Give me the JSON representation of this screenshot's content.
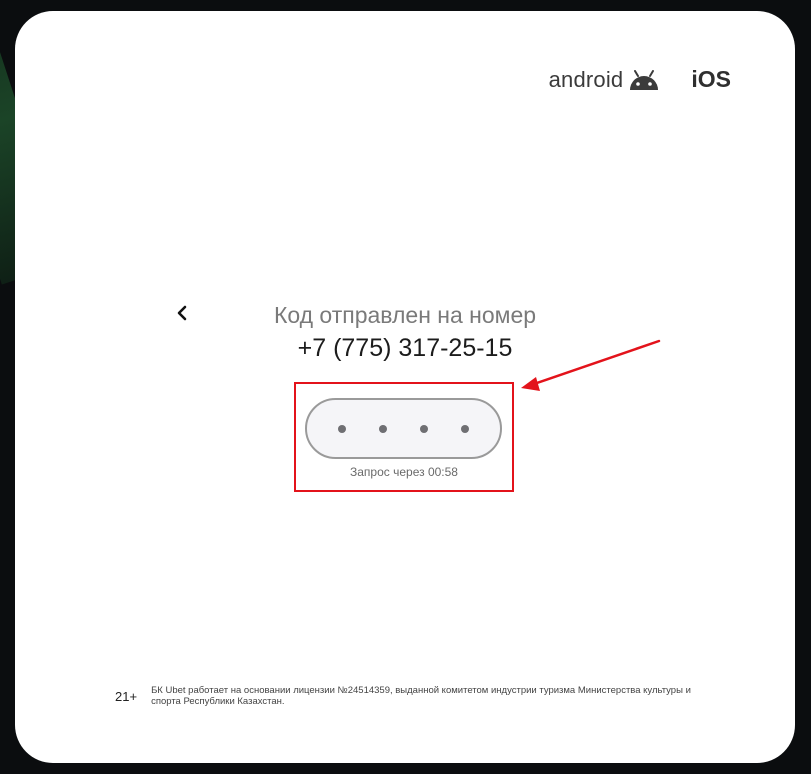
{
  "store_links": {
    "android_label": "android",
    "ios_label": "iOS"
  },
  "verification": {
    "title": "Код отправлен на номер",
    "phone": "+7 (775) 317-25-15",
    "code_digits": 4,
    "resend_text": "Запрос через 00:58"
  },
  "footer": {
    "age": "21+",
    "license": "БК Ubet работает на основании лицензии №24514359, выданной комитетом индустрии туризма Министерства культуры и спорта Республики Казахстан."
  },
  "colors": {
    "highlight": "#e3131b",
    "modal_bg": "#ffffff",
    "page_bg": "#0b0d0f"
  },
  "icons": {
    "back": "chevron-left-icon",
    "android": "android-robot-icon",
    "annotation": "red-arrow"
  }
}
